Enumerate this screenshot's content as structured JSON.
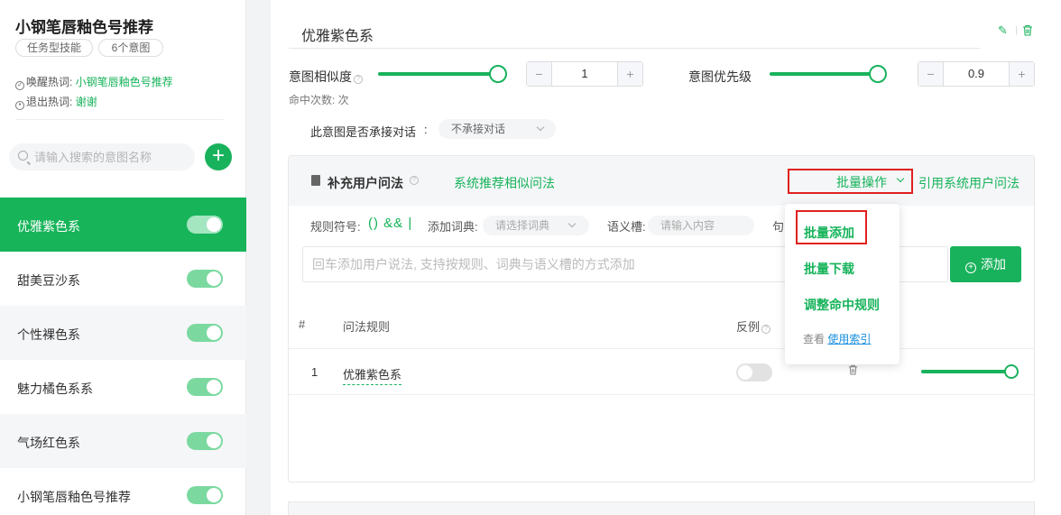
{
  "sidebar": {
    "skill_title": "小钢笔唇釉色号推荐",
    "tags": [
      "任务型技能",
      "6个意图"
    ],
    "wake_label": "唤醒热词: ",
    "wake_value": "小钢笔唇釉色号推荐",
    "exit_label": "退出热词: ",
    "exit_value": "谢谢",
    "search_placeholder": "请输入搜索的意图名称",
    "add_label": "+",
    "intents": [
      {
        "label": "优雅紫色系",
        "active": true,
        "enabled": true
      },
      {
        "label": "甜美豆沙系",
        "active": false,
        "enabled": true
      },
      {
        "label": "个性裸色系",
        "active": false,
        "enabled": true
      },
      {
        "label": "魅力橘色系系",
        "active": false,
        "enabled": true
      },
      {
        "label": "气场红色系",
        "active": false,
        "enabled": true
      },
      {
        "label": "小钢笔唇釉色号推荐",
        "active": false,
        "enabled": true
      }
    ]
  },
  "main": {
    "intent_name": "优雅紫色系",
    "similarity_label": "意图相似度",
    "similarity_value": "1",
    "similarity_level": 1.0,
    "priority_label": "意图优先级",
    "priority_value": "0.9",
    "priority_level": 1.0,
    "hits_label": "命中次数: 次",
    "dialog_label": "此意图是否承接对话",
    "dialog_colon": ":",
    "dialog_value": "不承接对话",
    "panel": {
      "title": "补充用户问法",
      "recommend_link": "系统推荐相似问法",
      "batch_label": "批量操作",
      "cite_link": "引用系统用户问法",
      "rule_symbol_label": "规则符号:",
      "rule_symbols": "() && |",
      "add_dict_label": "添加词典:",
      "dict_placeholder": "请选择词典",
      "slot_label": "语义槽:",
      "slot_placeholder": "请输入内容",
      "clause_label": "句",
      "input_placeholder": "回车添加用户说法, 支持按规则、词典与语义槽的方式添加",
      "add_button": "添加",
      "columns": [
        "#",
        "问法规则",
        "反例"
      ],
      "rows": [
        {
          "index": "1",
          "rule": "优雅紫色系",
          "negative": false,
          "level": 1.0
        }
      ]
    },
    "dropdown": {
      "items": [
        "批量添加",
        "批量下载",
        "调整命中规则"
      ],
      "foot_text": "查看 ",
      "foot_link": "使用索引"
    }
  },
  "colors": {
    "accent": "#19b25c",
    "highlight_border": "#e02020",
    "link_blue": "#1a8fe0"
  }
}
